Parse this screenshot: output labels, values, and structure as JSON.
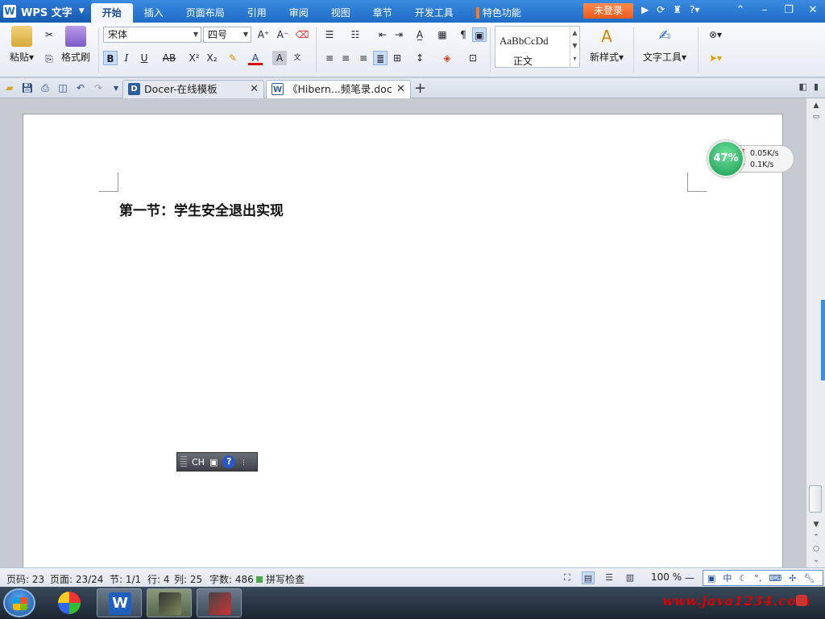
{
  "app": {
    "logo_text": "WPS 文字",
    "menu_tabs": [
      "开始",
      "插入",
      "页面布局",
      "引用",
      "审阅",
      "视图",
      "章节",
      "开发工具",
      "特色功能"
    ],
    "login_label": "未登录"
  },
  "ribbon": {
    "paste_label": "粘贴",
    "format_painter_label": "格式刷",
    "font_name": "宋体",
    "font_size": "四号",
    "style_sample": "AaBbCcDd",
    "style_name": "正文",
    "new_style_label": "新样式",
    "text_tools_label": "文字工具"
  },
  "tabs": {
    "items": [
      {
        "label": "Docer-在线模板",
        "active": false
      },
      {
        "label": "《Hibern...频笔录.doc",
        "active": true
      }
    ]
  },
  "document": {
    "heading": "第一节：学生安全退出实现"
  },
  "net_widget": {
    "percent": "47%",
    "upload": "0.05K/s",
    "download": "0.1K/s"
  },
  "ime_float": {
    "mode": "CH"
  },
  "status": {
    "page_code": "页码: 23",
    "pages": "页面: 23/24",
    "section": "节: 1/1",
    "row": "行: 4",
    "col": "列: 25",
    "word_count": "字数: 486",
    "spell_check": "拼写检查",
    "zoom": "100 %"
  },
  "ime_bar": {
    "lang": "中"
  },
  "taskbar": {
    "brand": "www.java1234.com"
  },
  "colors": {
    "title_blue": "#1f6cc6",
    "login_orange": "#e85a1c",
    "widget_green": "#1a9a52"
  }
}
